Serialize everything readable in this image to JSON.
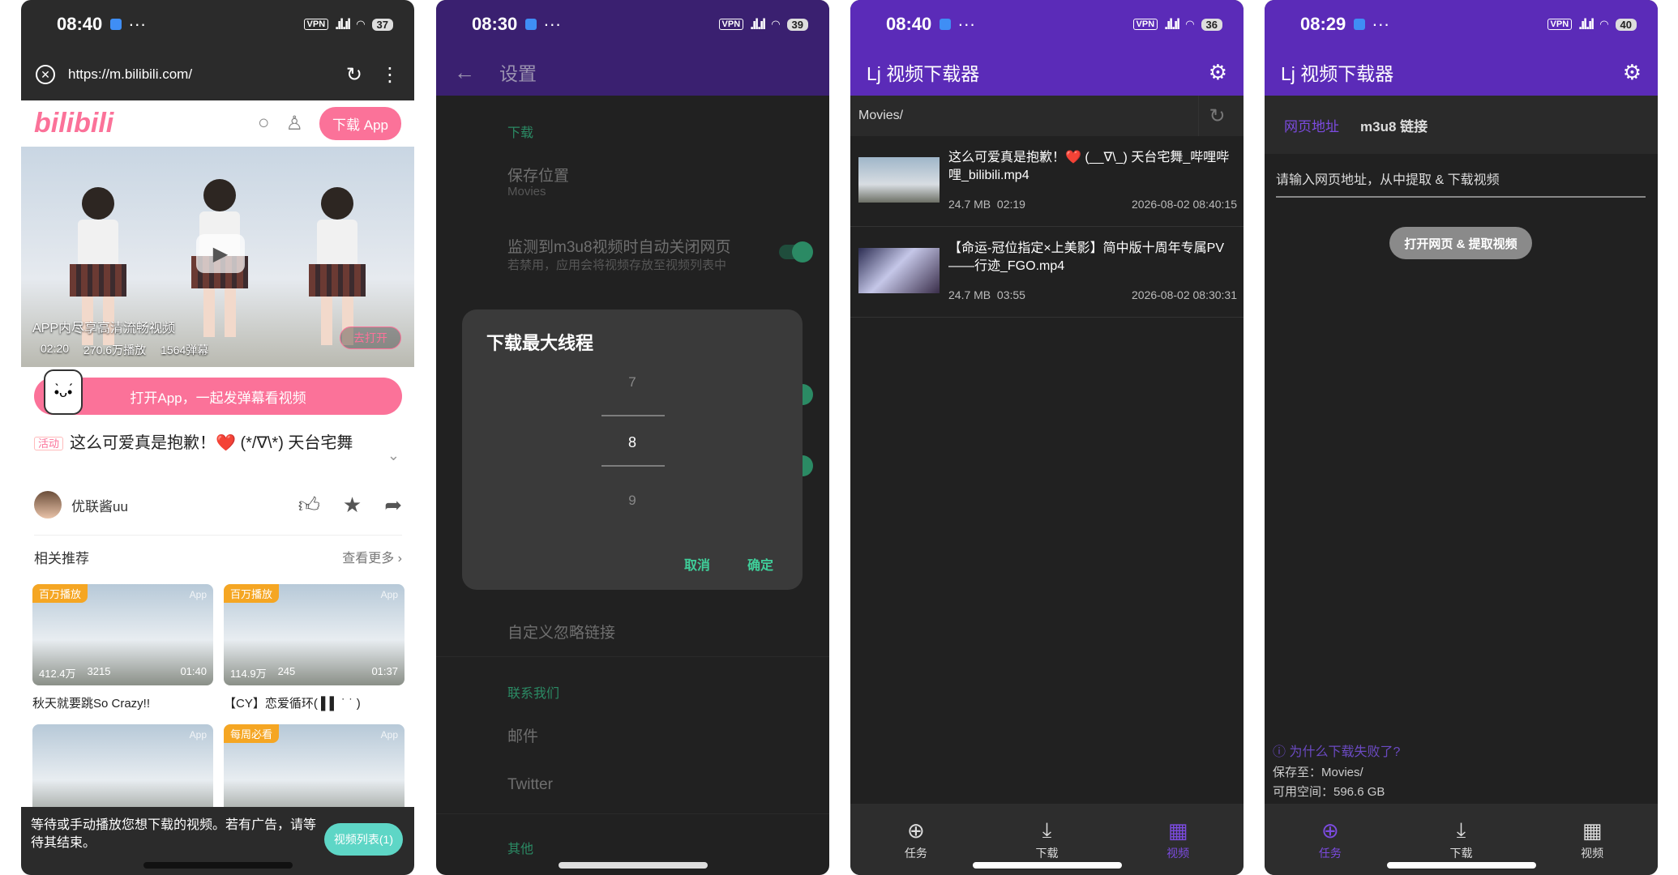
{
  "colors": {
    "bili_pink": "#fb7299",
    "purple": "#5b2bb8",
    "green_accent": "#3fcf9a"
  },
  "phone1": {
    "status": {
      "time": "08:40",
      "battery": "37"
    },
    "browser": {
      "url": "https://m.bilibili.com/"
    },
    "logo": "bilibili",
    "download_app": "下载 App",
    "video": {
      "overlay_title": "APP内尽享高清流畅视频",
      "duration": "02:20",
      "plays": "270.6万播放",
      "danmaku": "1564弹幕",
      "open_button": "去打开"
    },
    "open_app_banner": "打开App，一起发弹幕看视频",
    "title_tag": "活动",
    "title": "这么可爱真是抱歉！❤️ (*/∇\\*) 天台宅舞",
    "uploader": "优联酱uu",
    "related_label": "相关推荐",
    "see_more": "查看更多 ›",
    "cards": [
      {
        "badge": "百万播放",
        "app": "App",
        "plays": "412.4万",
        "danmaku": "3215",
        "duration": "01:40",
        "title": "秋天就要跳So Crazy!!"
      },
      {
        "badge": "百万播放",
        "app": "App",
        "plays": "114.9万",
        "danmaku": "245",
        "duration": "01:37",
        "title": "【CY】恋爱循环( ▌▌ ˙ ˙ )"
      },
      {
        "badge": "",
        "app": "App"
      },
      {
        "badge": "每周必看",
        "app": "App"
      }
    ],
    "bottom_tip": "等待或手动播放您想下载的视频。若有广告，请等待其结束。",
    "video_list_button": "视频列表(1)"
  },
  "phone2": {
    "status": {
      "time": "08:30",
      "battery": "39"
    },
    "title": "设置",
    "section_download": "下载",
    "save_location_label": "保存位置",
    "save_location_value": "Movies",
    "auto_close_label": "监测到m3u8视频时自动关闭网页",
    "auto_close_desc": "若禁用，应用会将视频存放至视频列表中",
    "custom_ignore": "自定义忽略链接",
    "section_contact": "联系我们",
    "mail": "邮件",
    "twitter": "Twitter",
    "section_other": "其他",
    "dialog": {
      "title": "下载最大线程",
      "prev": "7",
      "selected": "8",
      "next": "9",
      "cancel": "取消",
      "ok": "确定"
    }
  },
  "phone3": {
    "status": {
      "time": "08:40",
      "battery": "36"
    },
    "title": "Lj 视频下载器",
    "path": "Movies/",
    "files": [
      {
        "name": "这么可爱真是抱歉！❤️ (__∇\\_) 天台宅舞_哔哩哔哩_bilibili.mp4",
        "size": "24.7 MB",
        "duration": "02:19",
        "date": "2026-08-02 08:40:15"
      },
      {
        "name": "【命运-冠位指定×上美影】简中版十周年专属PV——行迹_FGO.mp4",
        "size": "24.7 MB",
        "duration": "03:55",
        "date": "2026-08-02 08:30:31"
      }
    ],
    "nav": {
      "tasks": "任务",
      "downloads": "下载",
      "videos": "视频"
    }
  },
  "phone4": {
    "status": {
      "time": "08:29",
      "battery": "40"
    },
    "title": "Lj 视频下载器",
    "tab_web": "网页地址",
    "tab_m3u8": "m3u8 链接",
    "url_placeholder": "请输入网页地址，从中提取 & 下载视频",
    "open_button": "打开网页 & 提取视频",
    "why_failed": "为什么下载失败了?",
    "save_to": "保存至：Movies/",
    "free_space": "可用空间：596.6 GB",
    "nav": {
      "tasks": "任务",
      "downloads": "下载",
      "videos": "视频"
    }
  }
}
